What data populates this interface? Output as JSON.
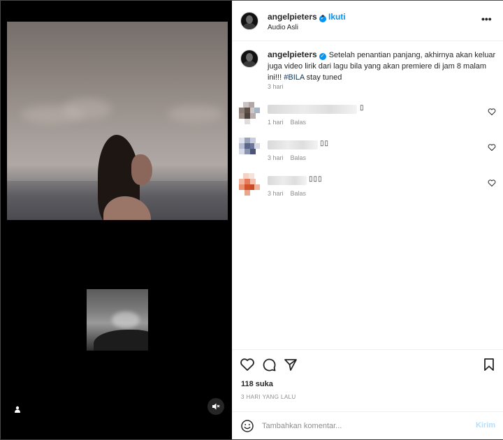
{
  "post": {
    "author": "angelpieters",
    "follow_label": "Ikuti",
    "dot": "•",
    "audio_label": "Audio Asli",
    "more_label": "•••",
    "caption_text": "Setelah penantian panjang, akhirnya akan keluar juga video lirik dari lagu bila yang akan premiere di jam 8 malam ini!!! ",
    "caption_hashtag": "#BILA",
    "caption_tail": " stay tuned",
    "caption_time": "3 hari"
  },
  "comments": [
    {
      "name_hidden": true,
      "emoji_glyph": "▯",
      "time": "1 hari",
      "reply": "Balas"
    },
    {
      "name_hidden": true,
      "emoji_glyph": "▯▯",
      "time": "3 hari",
      "reply": "Balas"
    },
    {
      "name_hidden": true,
      "emoji_glyph": "▯▯▯",
      "time": "3 hari",
      "reply": "Balas"
    }
  ],
  "stats": {
    "likes": "118 suka",
    "posted": "3 HARI YANG LALU"
  },
  "composer": {
    "placeholder": "Tambahkan komentar...",
    "send_label": "Kirim"
  },
  "icons": {
    "verified": "verified-badge",
    "like": "heart-icon",
    "comment": "comment-icon",
    "share": "paper-plane-icon",
    "save": "bookmark-icon",
    "emoji": "smiley-icon",
    "mute": "speaker-muted-icon",
    "tag": "user-tag-icon",
    "more": "more-options-icon"
  },
  "colors": {
    "accent": "#0095f6",
    "link": "#00376b",
    "muted_text": "#8e8e8e"
  }
}
